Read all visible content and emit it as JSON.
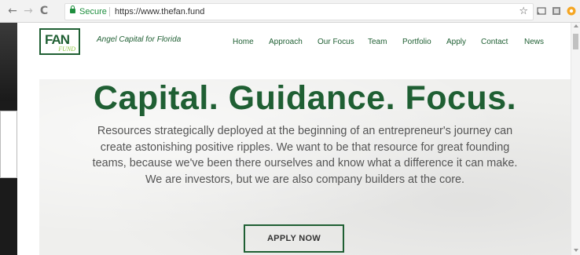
{
  "browser": {
    "secure_label": "Secure",
    "url": "https://www.thefan.fund",
    "back_glyph": "←",
    "forward_glyph": "→",
    "reload_glyph": "C",
    "star_glyph": "☆"
  },
  "header": {
    "logo_text": "FAN",
    "logo_subtext": "FUND",
    "tagline": "Angel Capital for Florida"
  },
  "nav": {
    "items": [
      "Home",
      "Approach",
      "Our Focus",
      "Team",
      "Portfolio",
      "Apply",
      "Contact",
      "News"
    ]
  },
  "hero": {
    "headline": "Capital. Guidance. Focus.",
    "paragraph_lines": [
      "Resources strategically deployed at the beginning of an entrepreneur's journey can",
      "create astonishing positive ripples.  We want to be that resource for great founding",
      "teams, because we've been there ourselves and know what a difference it can make.",
      "We are investors, but we are also company builders at the core."
    ],
    "cta_label": "APPLY NOW"
  },
  "colors": {
    "brand_green": "#1f5f33",
    "accent_lime": "#8dc63f",
    "secure_green": "#1e8e3e"
  }
}
